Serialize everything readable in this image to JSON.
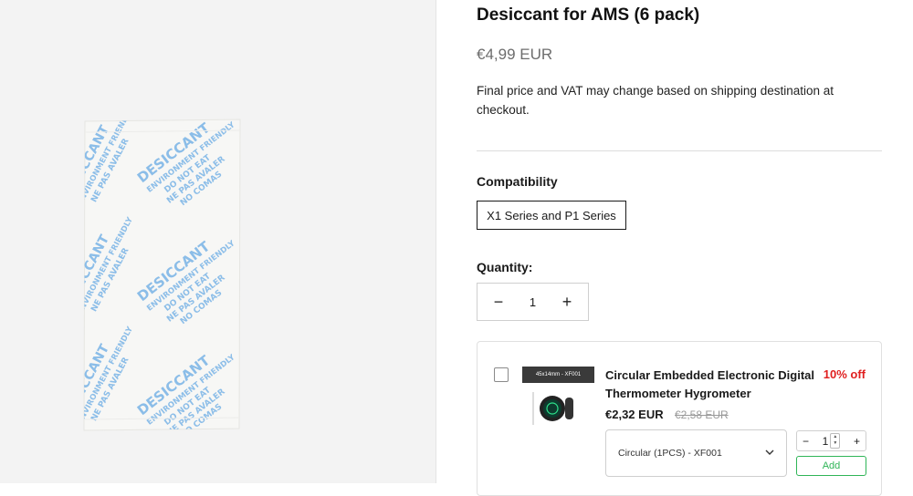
{
  "product": {
    "title": "Desiccant for AMS (6 pack)",
    "price": "€4,99 EUR",
    "note": "Final price and VAT may change based on shipping destination at checkout."
  },
  "product_image": {
    "packet_lines": [
      "DESICCANT",
      "ENVIRONMENT FRIENDLY",
      "DO NOT EAT",
      "NE PAS AVALER",
      "NO COMAS"
    ]
  },
  "compatibility": {
    "label": "Compatibility",
    "selected": "X1 Series and P1 Series"
  },
  "quantity": {
    "label": "Quantity:",
    "value": "1",
    "minus": "−",
    "plus": "+"
  },
  "upsell": {
    "thumb_label": "45x14mm - XF001",
    "title": "Circular Embedded Electronic Digital Thermometer Hygrometer",
    "discount": "10% off",
    "sale_price": "€2,32 EUR",
    "compare_price": "€2,58 EUR",
    "variant": "Circular (1PCS) - XF001",
    "qty": "1",
    "minus": "−",
    "plus": "+",
    "add_label": "Add"
  },
  "colors": {
    "discount": "#e02020",
    "add_button": "#2fb557",
    "image_bg": "#f3f3f3",
    "packet_text": "#7fb6e6"
  }
}
